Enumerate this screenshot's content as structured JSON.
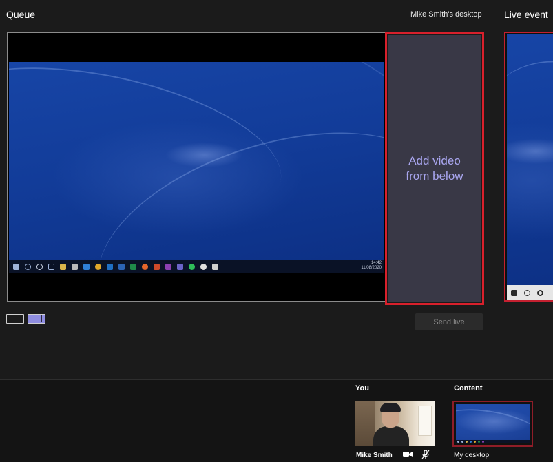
{
  "header": {
    "queue_title": "Queue",
    "source_label": "Mike Smith's desktop",
    "live_title": "Live event"
  },
  "queue": {
    "add_slot_text": "Add video from below",
    "clock_time": "14:42",
    "clock_date": "11/08/2020",
    "send_live_label": "Send live"
  },
  "participants": {
    "you_label": "You",
    "you_name": "Mike Smith",
    "content_label": "Content",
    "content_name": "My desktop"
  },
  "colors": {
    "background": "#1b1b1b",
    "accent_border": "#d8202c",
    "add_text": "#a9a6ef",
    "layout_active": "#8f8de0"
  },
  "icons": [
    "windows-start-icon",
    "search-icon",
    "cortana-icon",
    "task-view-icon",
    "camera-icon",
    "mic-off-icon"
  ]
}
